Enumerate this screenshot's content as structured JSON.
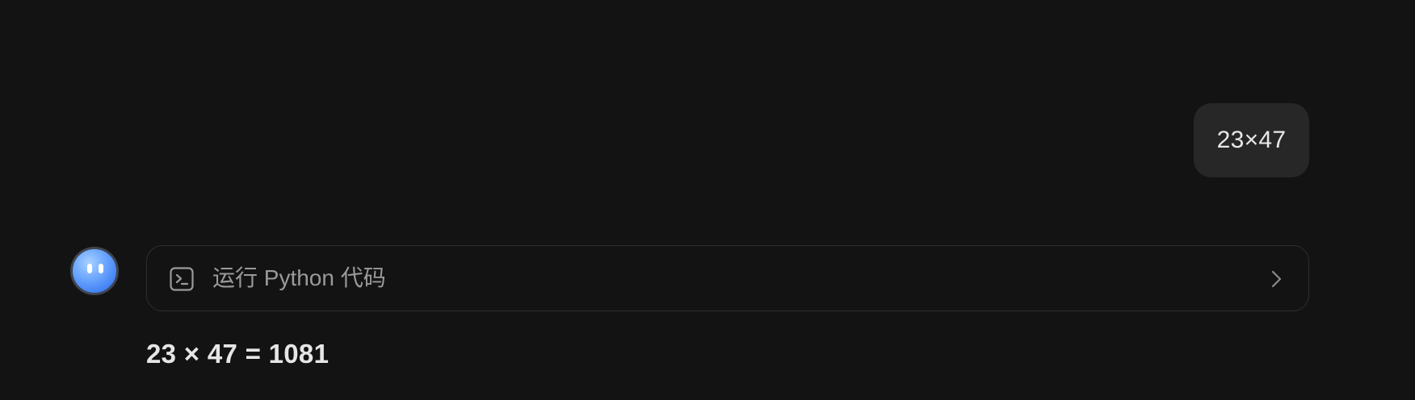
{
  "conversation": {
    "user_message": "23×47",
    "assistant": {
      "avatar_icon": "robot-face-icon",
      "tool_call": {
        "icon": "terminal-icon",
        "label": "运行 Python 代码",
        "expand_icon": "chevron-right-icon"
      },
      "answer": "23 × 47 = 1081"
    }
  },
  "colors": {
    "background": "#131313",
    "user_bubble": "#272727",
    "avatar_blue": "#4d8bf5",
    "border": "#2e2e2e"
  }
}
